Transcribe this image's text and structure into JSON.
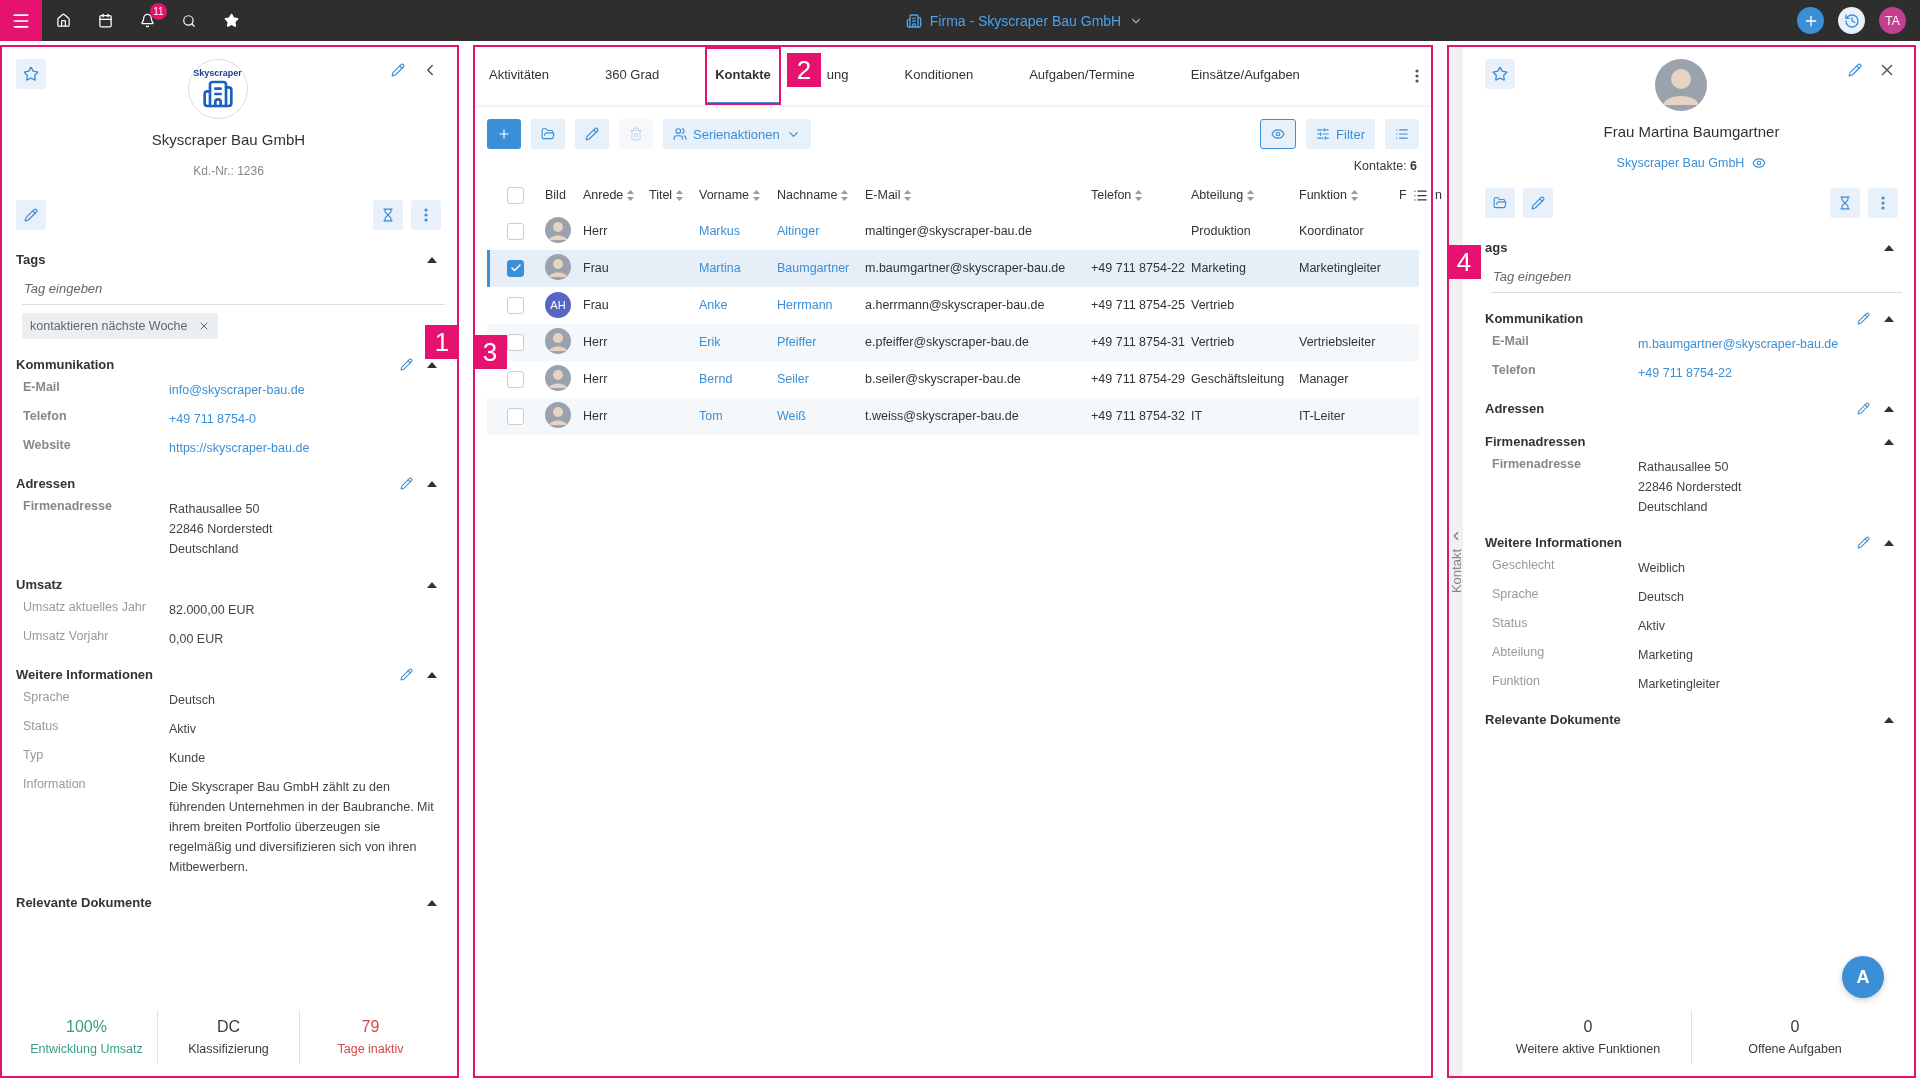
{
  "topbar": {
    "notification_count": "11",
    "title": "Firma - Skyscraper Bau GmbH",
    "user_initials": "TA"
  },
  "company": {
    "logo_text": "Skyscraper",
    "name": "Skyscraper Bau GmbH",
    "customer_number": "Kd.-Nr.: 1236",
    "tags_section": {
      "title": "Tags",
      "expanded": true,
      "placeholder": "Tag eingeben",
      "tags": [
        "kontaktieren nächste Woche"
      ]
    },
    "sections": [
      {
        "title": "Kommunikation",
        "editable": true,
        "expanded": true,
        "bold_labels": true,
        "fields": [
          {
            "label": "E-Mail",
            "kind": "link",
            "value": "info@skyscraper-bau.de"
          },
          {
            "label": "Telefon",
            "kind": "link",
            "value": "+49 711 8754-0"
          },
          {
            "label": "Website",
            "kind": "link",
            "value": "https://skyscraper-bau.de"
          }
        ]
      },
      {
        "title": "Adressen",
        "editable": true,
        "expanded": true,
        "bold_labels": true,
        "fields": [
          {
            "label": "Firmenadresse",
            "kind": "text",
            "value": "Rathausallee 50\n22846 Norderstedt\nDeutschland"
          }
        ]
      },
      {
        "title": "Umsatz",
        "editable": false,
        "expanded": true,
        "bold_labels": false,
        "fields": [
          {
            "label": "Umsatz aktuelles Jahr",
            "kind": "text",
            "value": "82.000,00 EUR"
          },
          {
            "label": "Umsatz Vorjahr",
            "kind": "text",
            "value": "0,00 EUR"
          }
        ]
      },
      {
        "title": "Weitere Informationen",
        "editable": true,
        "expanded": true,
        "bold_labels": false,
        "fields": [
          {
            "label": "Sprache",
            "kind": "text",
            "value": "Deutsch"
          },
          {
            "label": "Status",
            "kind": "text",
            "value": "Aktiv"
          },
          {
            "label": "Typ",
            "kind": "text",
            "value": "Kunde"
          },
          {
            "label": "Information",
            "kind": "text",
            "value": "Die Skyscraper Bau GmbH zählt zu den führenden Unternehmen in der Baubranche. Mit ihrem breiten Portfolio überzeugen sie regelmäßig und diversifizieren sich von ihren Mitbewerbern."
          }
        ]
      },
      {
        "title": "Relevante Dokumente",
        "editable": false,
        "expanded": true
      }
    ],
    "stats": [
      {
        "value": "100%",
        "label": "Entwicklung Umsatz",
        "color": "#3d9c88"
      },
      {
        "value": "DC",
        "label": "Klassifizierung",
        "color": "#3a3a3a"
      },
      {
        "value": "79",
        "label": "Tage inaktiv",
        "color": "#d64545"
      }
    ]
  },
  "tabs": [
    {
      "label": "Aktivitäten",
      "selected": false
    },
    {
      "label": "360 Grad",
      "selected": false
    },
    {
      "label": "Kontakte",
      "selected": true
    },
    {
      "label": "ung",
      "selected": false
    },
    {
      "label": "Konditionen",
      "selected": false
    },
    {
      "label": "Aufgaben/Termine",
      "selected": false
    },
    {
      "label": "Einsätze/Aufgaben",
      "selected": false
    }
  ],
  "toolbar": [
    {
      "kind": "add"
    },
    {
      "kind": "folder"
    },
    {
      "kind": "edit"
    },
    {
      "kind": "delete",
      "disabled": true
    },
    {
      "kind": "series",
      "label": "Serienaktionen"
    },
    {
      "kind": "view",
      "active": true
    },
    {
      "kind": "filter",
      "label": "Filter"
    },
    {
      "kind": "list"
    }
  ],
  "count": "Kontakte: **6**",
  "table": {
    "select_all_checked": false,
    "columns": [
      {
        "label": "Bild",
        "sortable": false
      },
      {
        "label": "Anrede",
        "sortable": true
      },
      {
        "label": "Titel",
        "sortable": true
      },
      {
        "label": "Vorname",
        "sortable": true
      },
      {
        "label": "Nachname",
        "sortable": true
      },
      {
        "label": "E-Mail",
        "sortable": true
      },
      {
        "label": "Telefon",
        "sortable": true
      },
      {
        "label": "Abteilung",
        "sortable": true
      },
      {
        "label": "Funktion",
        "sortable": true
      },
      {
        "label": "F",
        "sortable": false
      },
      {
        "label": "n",
        "sortable": false
      }
    ],
    "rows": [
      {
        "selected": false,
        "checked": false,
        "avatar": {
          "kind": "photo"
        },
        "anrede": "Herr",
        "vorname": "Markus",
        "nachname": "Altinger",
        "email": "maltinger@skyscraper-bau.de",
        "abteilung": "Produktion",
        "funktion": "Koordinator"
      },
      {
        "selected": true,
        "checked": true,
        "avatar": {
          "kind": "photo"
        },
        "anrede": "Frau",
        "vorname": "Martina",
        "nachname": "Baumgartner",
        "email": "m.baumgartner@skyscraper-bau.de",
        "telefon": "+49 711 8754-22",
        "abteilung": "Marketing",
        "funktion": "Marketingleiter"
      },
      {
        "selected": false,
        "checked": false,
        "avatar": {
          "kind": "initials",
          "initials": "AH"
        },
        "anrede": "Frau",
        "vorname": "Anke",
        "nachname": "Herrmann",
        "email": "a.herrmann@skyscraper-bau.de",
        "telefon": "+49 711 8754-25",
        "abteilung": "Vertrieb"
      },
      {
        "selected": false,
        "checked": false,
        "avatar": {
          "kind": "photo"
        },
        "anrede": "Herr",
        "vorname": "Erik",
        "nachname": "Pfeiffer",
        "email": "e.pfeiffer@skyscraper-bau.de",
        "telefon": "+49 711 8754-31",
        "abteilung": "Vertrieb",
        "funktion": "Vertriebsleiter"
      },
      {
        "selected": false,
        "checked": false,
        "avatar": {
          "kind": "photo"
        },
        "anrede": "Herr",
        "vorname": "Bernd",
        "nachname": "Seiler",
        "email": "b.seiler@skyscraper-bau.de",
        "telefon": "+49 711 8754-29",
        "abteilung": "Geschäftsleitung",
        "funktion": "Manager"
      },
      {
        "selected": false,
        "checked": false,
        "avatar": {
          "kind": "photo"
        },
        "anrede": "Herr",
        "vorname": "Tom",
        "nachname": "Weiß",
        "email": "t.weiss@skyscraper-bau.de",
        "telefon": "+49 711 8754-32",
        "abteilung": "IT",
        "funktion": "IT-Leiter"
      }
    ]
  },
  "contact": {
    "name": "Frau Martina Baumgartner",
    "company": "Skyscraper Bau GmbH",
    "side_tab": "Kontakt",
    "tags_section": {
      "title": "ags",
      "expanded": true,
      "placeholder": "Tag eingeben"
    },
    "sections": [
      {
        "title": "Kommunikation",
        "editable": true,
        "expanded": true,
        "bold_labels": true,
        "fields": [
          {
            "label": "E-Mail",
            "kind": "link",
            "value": "m.baumgartner@skyscraper-bau.de"
          },
          {
            "label": "Telefon",
            "kind": "link",
            "value": "+49 711 8754-22"
          }
        ]
      },
      {
        "title": "Adressen",
        "editable": true,
        "expanded": true
      },
      {
        "title": "Firmenadressen",
        "editable": false,
        "expanded": true,
        "bold_labels": true,
        "fields": [
          {
            "label": "Firmenadresse",
            "kind": "text",
            "value": "Rathausallee 50\n22846 Norderstedt\nDeutschland"
          }
        ]
      },
      {
        "title": "Weitere Informationen",
        "editable": true,
        "expanded": true,
        "bold_labels": false,
        "fields": [
          {
            "label": "Geschlecht",
            "kind": "text",
            "value": "Weiblich"
          },
          {
            "label": "Sprache",
            "kind": "text",
            "value": "Deutsch"
          },
          {
            "label": "Status",
            "kind": "text",
            "value": "Aktiv"
          },
          {
            "label": "Abteilung",
            "kind": "text",
            "value": "Marketing"
          },
          {
            "label": "Funktion",
            "kind": "text",
            "value": "Marketingleiter"
          }
        ]
      },
      {
        "title": "Relevante Dokumente",
        "editable": false,
        "expanded": true
      }
    ],
    "fab_label": "A",
    "stats": [
      {
        "value": "0",
        "label": "Weitere aktive Funktionen",
        "color": "#3a3a3a"
      },
      {
        "value": "0",
        "label": "Offene Aufgaben",
        "color": "#3a3a3a"
      }
    ]
  },
  "callouts": [
    "1",
    "2",
    "3",
    "4"
  ]
}
